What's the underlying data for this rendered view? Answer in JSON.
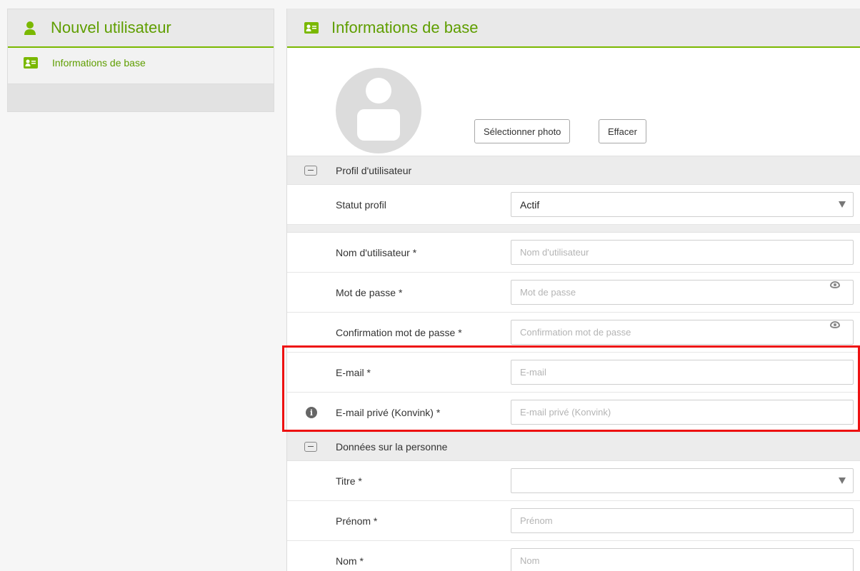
{
  "colors": {
    "accent": "#7ab800",
    "accent_text": "#5f9e00",
    "highlight": "#e11111"
  },
  "sidebar": {
    "header_icon": "user-icon",
    "title": "Nouvel utilisateur",
    "items": [
      {
        "icon": "id-card-icon",
        "label": "Informations de base"
      }
    ]
  },
  "main": {
    "header_icon": "id-card-icon",
    "title": "Informations de base",
    "photo": {
      "select_label": "Sélectionner photo",
      "clear_label": "Effacer"
    },
    "sections": {
      "profile": {
        "title": "Profil d'utilisateur",
        "status_label": "Statut profil",
        "status_value": "Actif",
        "username_label": "Nom d'utilisateur *",
        "username_placeholder": "Nom d'utilisateur",
        "password_label": "Mot de passe *",
        "password_placeholder": "Mot de passe",
        "confirm_label": "Confirmation mot de passe *",
        "confirm_placeholder": "Confirmation mot de passe",
        "email_label": "E-mail *",
        "email_placeholder": "E-mail",
        "private_email_label": "E-mail privé (Konvink) *",
        "private_email_placeholder": "E-mail privé (Konvink)"
      },
      "person": {
        "title": "Données sur la personne",
        "title_label": "Titre *",
        "title_value": "",
        "firstname_label": "Prénom *",
        "firstname_placeholder": "Prénom",
        "lastname_label": "Nom *",
        "lastname_placeholder": "Nom"
      }
    }
  }
}
